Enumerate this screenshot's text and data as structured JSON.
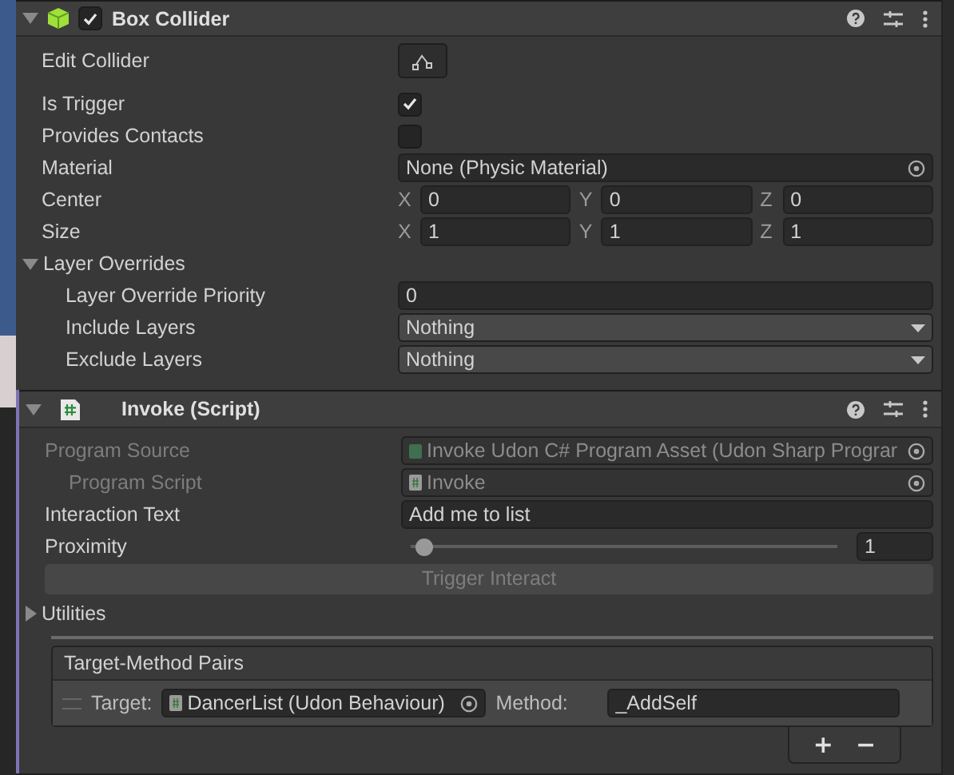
{
  "box_collider": {
    "title": "Box Collider",
    "enabled": true,
    "expanded": true,
    "rows": [
      {
        "kind": "button",
        "label": "Edit Collider"
      },
      {
        "kind": "checkbox",
        "label": "Is Trigger",
        "checked": true
      },
      {
        "kind": "checkbox",
        "label": "Provides Contacts",
        "checked": false
      },
      {
        "kind": "object",
        "label": "Material",
        "value": "None (Physic Material)"
      },
      {
        "kind": "vector3",
        "label": "Center",
        "axes": [
          {
            "axis": "X",
            "value": "0"
          },
          {
            "axis": "Y",
            "value": "0"
          },
          {
            "axis": "Z",
            "value": "0"
          }
        ]
      },
      {
        "kind": "vector3",
        "label": "Size",
        "axes": [
          {
            "axis": "X",
            "value": "1"
          },
          {
            "axis": "Y",
            "value": "1"
          },
          {
            "axis": "Z",
            "value": "1"
          }
        ]
      },
      {
        "kind": "foldout",
        "label": "Layer Overrides",
        "expanded": true,
        "children": [
          {
            "kind": "int",
            "label": "Layer Override Priority",
            "value": "0"
          },
          {
            "kind": "dropdown",
            "label": "Include Layers",
            "value": "Nothing"
          },
          {
            "kind": "dropdown",
            "label": "Exclude Layers",
            "value": "Nothing"
          }
        ]
      }
    ]
  },
  "invoke_script": {
    "title": "Invoke (Script)",
    "expanded": true,
    "rows": [
      {
        "kind": "object",
        "label": "Program Source",
        "value": "Invoke Udon C# Program Asset (Udon Sharp Prograr",
        "disabled": true,
        "children": [
          {
            "kind": "object",
            "label": "Program Script",
            "value": "Invoke",
            "disabled": true
          }
        ]
      },
      {
        "kind": "text",
        "label": "Interaction Text",
        "value": "Add me to list"
      },
      {
        "kind": "slider",
        "label": "Proximity",
        "level": 0.01,
        "value": "1"
      },
      {
        "kind": "action",
        "label": "Trigger Interact",
        "disabled": true
      },
      {
        "kind": "foldout",
        "label": "Utilities",
        "expanded": false
      }
    ],
    "pairs": {
      "title": "Target-Method Pairs",
      "items": [
        {
          "target_label": "Target:",
          "target": "DancerList (Udon Behaviour)",
          "method_label": "Method:",
          "method": "_AddSelf"
        }
      ],
      "add": "+",
      "remove": "−"
    }
  }
}
